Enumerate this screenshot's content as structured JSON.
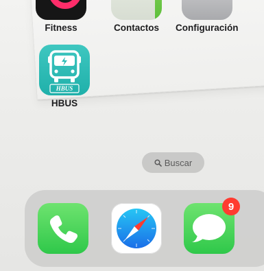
{
  "home_screen": {
    "apps": [
      {
        "label": "Fitness",
        "icon": "fitness-icon"
      },
      {
        "label": "Contactos",
        "icon": "contacts-icon"
      },
      {
        "label": "Configuración",
        "icon": "settings-gear-icon"
      },
      {
        "label": "HBUS",
        "icon": "hbus-bus-icon",
        "icon_text": "HBUS"
      }
    ],
    "search": {
      "label": "Buscar",
      "icon": "magnifier-icon"
    }
  },
  "dock": {
    "apps": [
      {
        "name": "phone",
        "icon": "phone-icon"
      },
      {
        "name": "safari",
        "icon": "compass-icon"
      },
      {
        "name": "messages",
        "icon": "message-bubble-icon",
        "badge": "9"
      }
    ]
  },
  "colors": {
    "badge": "#ff3b30",
    "green_app": "#34c759",
    "hbus_teal": "#2dbdb6"
  }
}
